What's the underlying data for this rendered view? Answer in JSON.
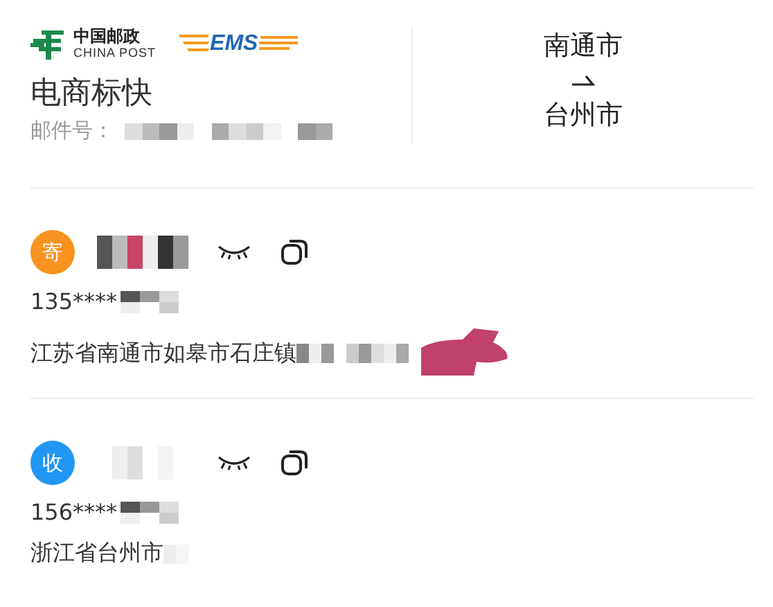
{
  "header": {
    "logo": {
      "cn": "中国邮政",
      "en": "CHINA POST",
      "ems": "EMS"
    },
    "service": "电商标快",
    "tracking_label": "邮件号：",
    "route": {
      "from": "南通市",
      "to": "台州市"
    }
  },
  "parties": [
    {
      "kind": "sender",
      "badge": "寄",
      "color": "#f7931e",
      "phone": "135****",
      "address": "江苏省南通市如皋市石庄镇"
    },
    {
      "kind": "receiver",
      "badge": "收",
      "color": "#2196f3",
      "phone": "156****",
      "address": "浙江省台州市"
    }
  ]
}
